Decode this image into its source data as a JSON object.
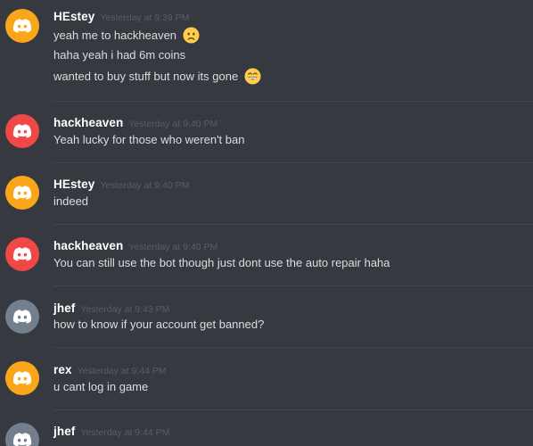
{
  "colors": {
    "background": "#36393f",
    "avatar_orange": "#faa61a",
    "avatar_red": "#f04747",
    "avatar_gray": "#747f8d",
    "username": "#ffffff",
    "timestamp": "#5a5d63",
    "message_text": "#dcddde",
    "divider": "#42454a"
  },
  "messages": [
    {
      "author": "HEstey",
      "avatar_color": "orange",
      "timestamp": "Yesterday at 9:39 PM",
      "lines": [
        {
          "text": "yeah me to hackheaven",
          "emoji": "worried-face-emoji"
        },
        {
          "text": "haha yeah i had 6m coins"
        },
        {
          "text": "wanted to buy stuff but now its gone",
          "emoji": "grinning-smile-emoji"
        }
      ]
    },
    {
      "author": "hackheaven",
      "avatar_color": "red",
      "timestamp": "Yesterday at 9:40 PM",
      "lines": [
        {
          "text": "Yeah lucky for those who weren't ban"
        }
      ]
    },
    {
      "author": "HEstey",
      "avatar_color": "orange",
      "timestamp": "Yesterday at 9:40 PM",
      "lines": [
        {
          "text": "indeed"
        }
      ]
    },
    {
      "author": "hackheaven",
      "avatar_color": "red",
      "timestamp": "Yesterday at 9:40 PM",
      "lines": [
        {
          "text": "You can still use the bot though just dont use the auto repair haha"
        }
      ]
    },
    {
      "author": "jhef",
      "avatar_color": "gray",
      "timestamp": "Yesterday at 9:43 PM",
      "lines": [
        {
          "text": "how to know if your account get banned?"
        }
      ]
    },
    {
      "author": "rex",
      "avatar_color": "orange",
      "timestamp": "Yesterday at 9:44 PM",
      "lines": [
        {
          "text": "u cant log in game"
        }
      ]
    },
    {
      "author": "jhef",
      "avatar_color": "gray",
      "timestamp": "Yesterday at 9:44 PM",
      "lines": []
    }
  ]
}
